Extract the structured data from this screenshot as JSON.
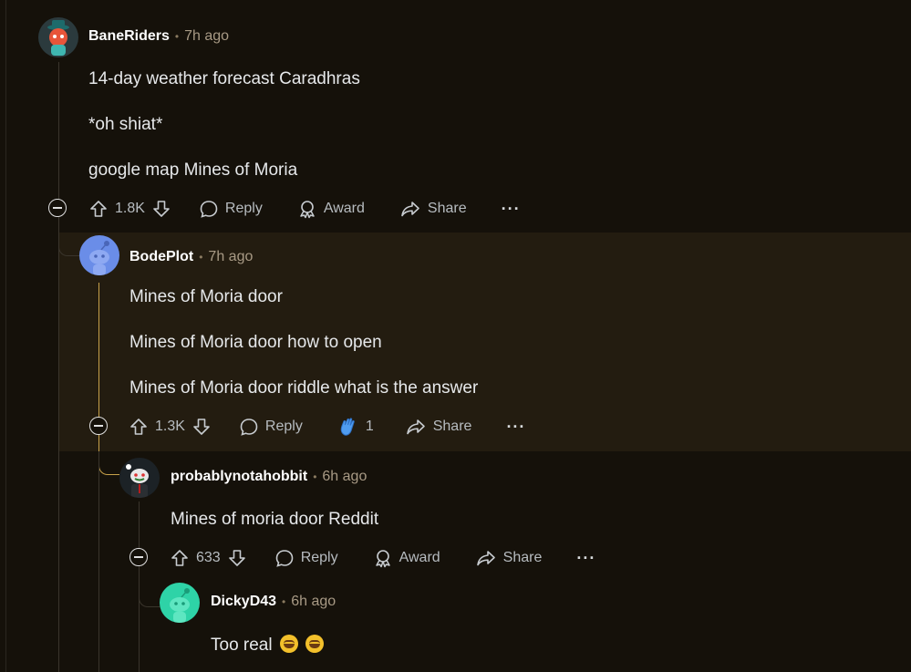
{
  "comments": [
    {
      "username": "BaneRiders",
      "time": "7h ago",
      "body": [
        "14-day weather forecast Caradhras",
        "*oh shiat*",
        "google map Mines of Moria"
      ],
      "votes": "1.8K",
      "reply_label": "Reply",
      "award_label": "Award",
      "share_label": "Share",
      "more_label": "···"
    },
    {
      "username": "BodePlot",
      "time": "7h ago",
      "body": [
        "Mines of Moria door",
        "Mines of Moria door how to open",
        "Mines of Moria door riddle what is the answer"
      ],
      "votes": "1.3K",
      "reply_label": "Reply",
      "award_count": "1",
      "share_label": "Share",
      "more_label": "···"
    },
    {
      "username": "probablynotahobbit",
      "time": "6h ago",
      "body": [
        "Mines of moria door Reddit"
      ],
      "votes": "633",
      "reply_label": "Reply",
      "award_label": "Award",
      "share_label": "Share",
      "more_label": "···"
    },
    {
      "username": "DickyD43",
      "time": "6h ago",
      "body": [
        "Too real"
      ]
    }
  ],
  "colors": {
    "background": "#15110a",
    "highlight": "#231c10",
    "thread_gold": "#c8a24a",
    "award_blue": "#4f9cf0"
  },
  "icons": [
    "upvote-icon",
    "downvote-icon",
    "reply-bubble-icon",
    "award-icon",
    "share-icon",
    "clap-award-icon",
    "laughing-emoji-icon"
  ]
}
